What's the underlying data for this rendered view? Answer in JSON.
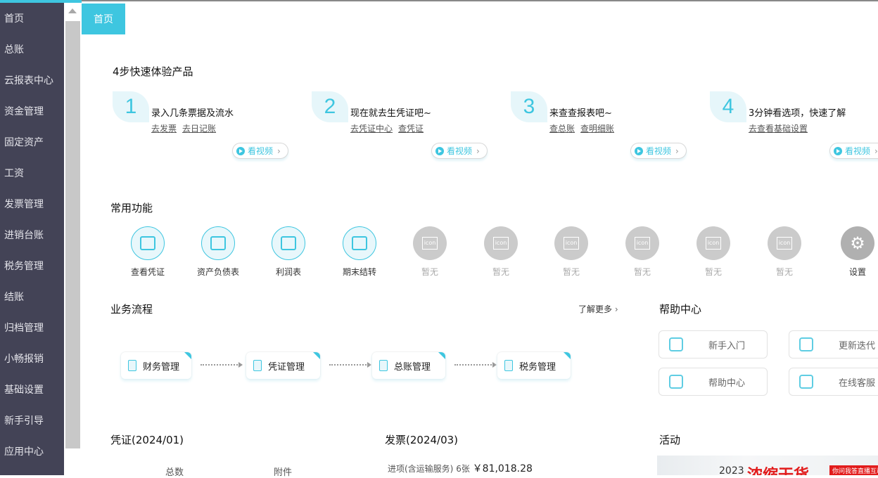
{
  "sidebar": {
    "items": [
      "首页",
      "总账",
      "云报表中心",
      "资金管理",
      "固定资产",
      "工资",
      "发票管理",
      "进销台账",
      "税务管理",
      "结账",
      "归档管理",
      "小畅报销",
      "基础设置",
      "新手引导",
      "应用中心"
    ]
  },
  "tab": {
    "label": "首页"
  },
  "quickstart": {
    "title": "4步快速体验产品",
    "video_label": "看视频",
    "steps": [
      {
        "num": "1",
        "title": "录入几条票据及流水",
        "links": [
          "去发票",
          "去日记账"
        ]
      },
      {
        "num": "2",
        "title": "现在就去生凭证吧~",
        "links": [
          "去凭证中心",
          "查凭证"
        ]
      },
      {
        "num": "3",
        "title": "来查查报表吧~",
        "links": [
          "查总账",
          "查明细账"
        ]
      },
      {
        "num": "4",
        "title": "3分钟看选项，快速了解",
        "links": [
          "去查看基础设置"
        ]
      }
    ]
  },
  "functions": {
    "title": "常用功能",
    "items": [
      {
        "label": "查看凭证",
        "state": "on",
        "icon": "voucher-search-icon"
      },
      {
        "label": "资产负债表",
        "state": "on",
        "icon": "balance-sheet-icon"
      },
      {
        "label": "利润表",
        "state": "on",
        "icon": "profit-chart-icon"
      },
      {
        "label": "期末结转",
        "state": "on",
        "icon": "period-close-icon"
      },
      {
        "label": "暂无",
        "state": "off",
        "icon": "placeholder-icon"
      },
      {
        "label": "暂无",
        "state": "off",
        "icon": "placeholder-icon"
      },
      {
        "label": "暂无",
        "state": "off",
        "icon": "placeholder-icon"
      },
      {
        "label": "暂无",
        "state": "off",
        "icon": "placeholder-icon"
      },
      {
        "label": "暂无",
        "state": "off",
        "icon": "placeholder-icon"
      },
      {
        "label": "暂无",
        "state": "off",
        "icon": "placeholder-icon"
      },
      {
        "label": "设置",
        "state": "set",
        "icon": "gear-icon"
      }
    ],
    "placeholder_icon_text": "icon"
  },
  "process": {
    "title": "业务流程",
    "more": "了解更多",
    "items": [
      "财务管理",
      "凭证管理",
      "总账管理",
      "税务管理"
    ]
  },
  "help": {
    "title": "帮助中心",
    "items": [
      "新手入门",
      "更新迭代",
      "帮助中心",
      "在线客服"
    ]
  },
  "voucher": {
    "title": "凭证(2024/01)",
    "cols": [
      "总数",
      "附件"
    ]
  },
  "invoice": {
    "title": "发票(2024/03)",
    "line_label": "进项(含运输服务)",
    "line_count": "6张",
    "line_amount": "￥81,018.28"
  },
  "activity": {
    "title": "活动",
    "banner_year": "2023",
    "banner_title": "浓缩干货",
    "banner_tag": "你问我答直播互动"
  }
}
